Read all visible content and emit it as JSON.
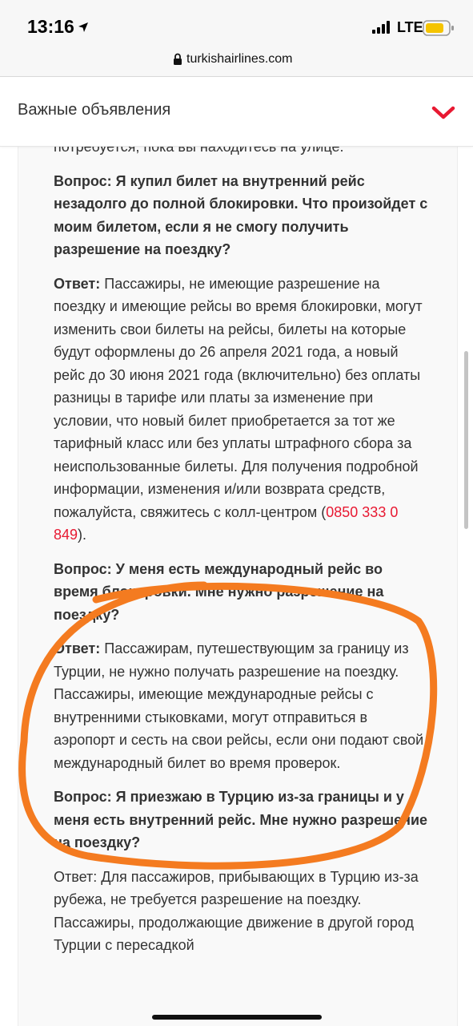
{
  "status_bar": {
    "time": "13:16",
    "network": "LTE",
    "battery_color": "#f5c400"
  },
  "browser": {
    "url": "turkishairlines.com"
  },
  "header": {
    "title": "Важные объявления",
    "chevron_color": "#e81932"
  },
  "content": {
    "partial_line": "потребуется, пока вы находитесь на улице.",
    "qa": [
      {
        "question": "Вопрос: Я купил билет на внутренний рейс незадолго до полной блокировки. Что произойдет с моим билетом, если я не смогу получить разрешение на поездку?",
        "answer_label": "Ответ:",
        "answer": "Пассажиры, не имеющие разрешение на поездку и имеющие рейсы во время блокировки, могут изменить свои билеты на рейсы, билеты на которые будут оформлены до 26 апреля 2021 года, а новый рейс до 30 июня 2021 года (включительно) без оплаты разницы в тарифе или платы за изменение при условии, что новый билет приобретается за тот же тарифный класс или без уплаты штрафного сбора за неиспользованные билеты. Для получения подробной информации, изменения и/или возврата средств, пожалуйста, свяжитесь с колл-центром (",
        "phone": "0850 333 0 849",
        "answer_end": ")."
      },
      {
        "question": "Вопрос: У меня есть международный рейс во время блокировки. Мне нужно разрешение на поездку?",
        "answer_label": "Ответ:",
        "answer": "Пассажирам, путешествующим за границу из Турции, не нужно получать разрешение на поездку. Пассажиры, имеющие международные рейсы с внутренними стыковками, могут отправиться в аэропорт и сесть на свои рейсы, если они подают свой международный билет во время проверок."
      },
      {
        "question": "Вопрос: Я приезжаю в Турцию из-за границы и у меня есть внутренний рейс. Мне нужно разрешение на поездку?",
        "answer": "Ответ: Для пассажиров, прибывающих в Турцию из-за рубежа, не требуется разрешение на поездку. Пассажиры, продолжающие движение в другой город Турции с пересадкой"
      }
    ]
  },
  "annotation_color": "#f47b20"
}
